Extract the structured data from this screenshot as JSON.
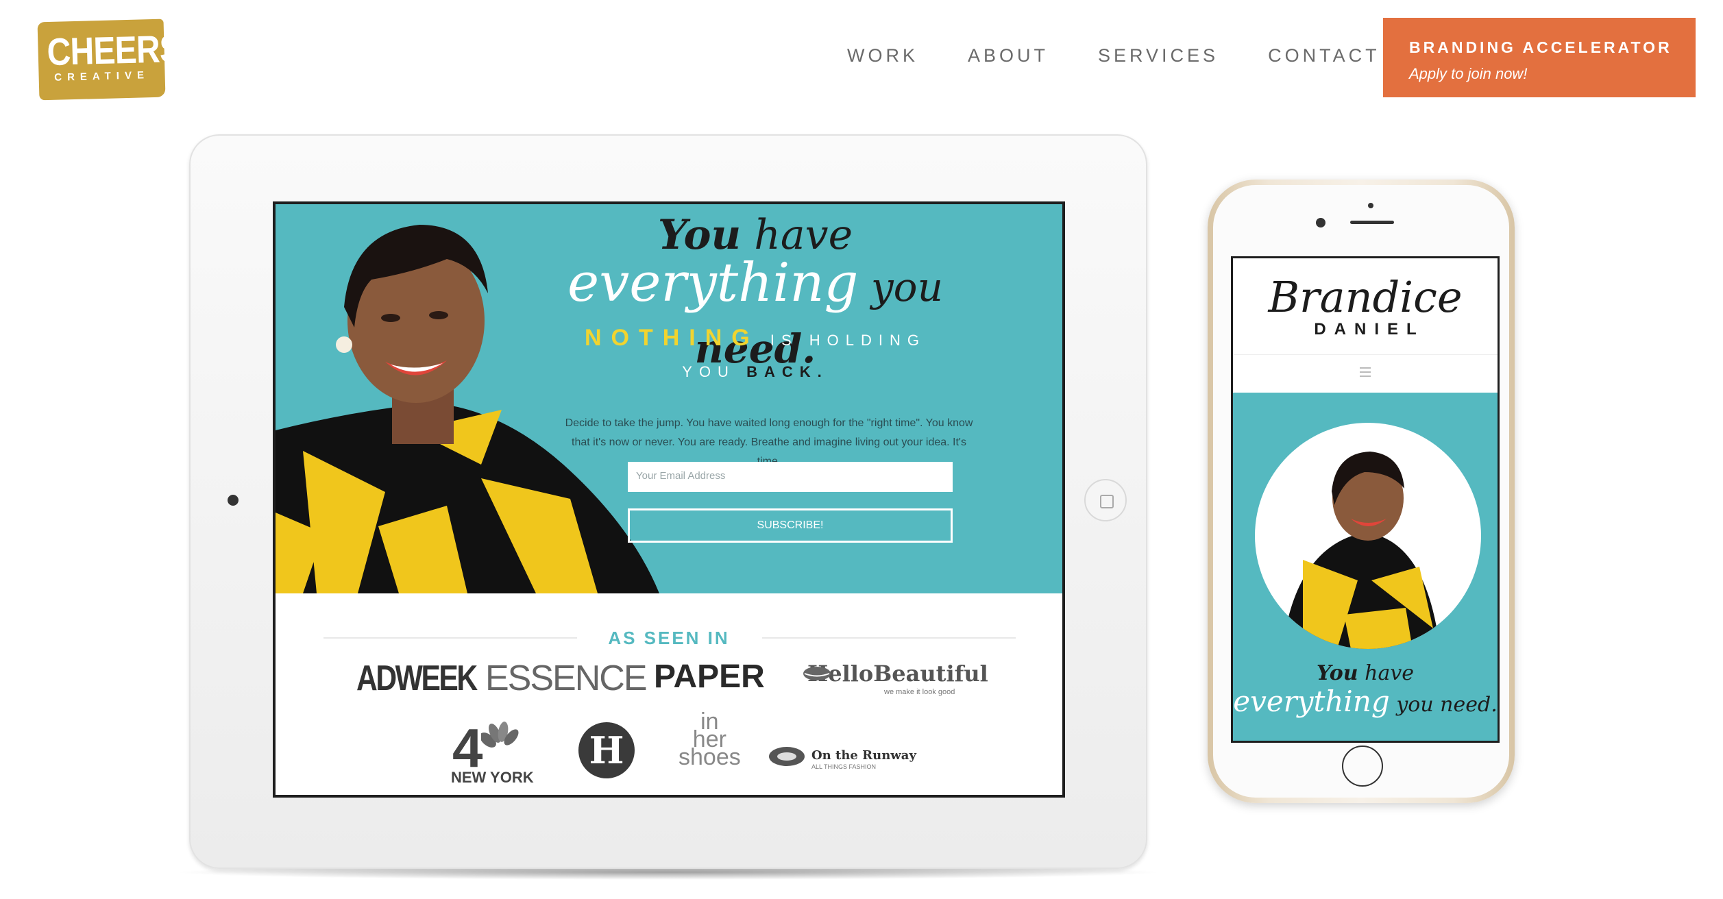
{
  "header": {
    "logo_main": "CHEERS",
    "logo_sub": "CREATIVE",
    "nav": [
      "WORK",
      "ABOUT",
      "SERVICES",
      "CONTACT"
    ],
    "cta_title": "BRANDING ACCELERATOR",
    "cta_subtitle": "Apply to join now!"
  },
  "tablet": {
    "headline_1a": "You",
    "headline_1b": " have",
    "headline_2a": "everything",
    "headline_2b": " you ",
    "headline_2c": "need.",
    "headline_3a": "NOTHING",
    "headline_3b": " IS HOLDING",
    "headline_4a": "YOU ",
    "headline_4b": "BACK.",
    "description": "Decide to take the jump. You have waited long enough for the \"right time\". You know that it's now or never. You are ready. Breathe and imagine living out your idea. It's time.",
    "email_placeholder": "Your Email Address",
    "subscribe_label": "SUBSCRIBE!",
    "as_seen_in": "AS SEEN IN",
    "brands_row1": [
      "ADWEEK",
      "ESSENCE",
      "PAPER",
      "HelloBeautiful"
    ],
    "brand_hb_tag": "we make it look good",
    "brands_row2_4": "4",
    "brands_row2_ny": "NEW YORK",
    "brands_row2_h": "H",
    "brands_row2_inher_1": "in",
    "brands_row2_inher_2": "her",
    "brands_row2_inher_3": "shoes",
    "brands_row2_runway": "On the Runway",
    "brands_row2_runway_tag": "ALL THINGS FASHION"
  },
  "phone": {
    "title": "Brandice",
    "subtitle": "DANIEL",
    "headline_1a": "You",
    "headline_1b": " have",
    "headline_2a": "everything",
    "headline_2b": " you need."
  },
  "colors": {
    "teal": "#55b9c0",
    "yellow": "#f1d42f",
    "cta_orange": "#e3703f",
    "logo_gold": "#c9a23c"
  }
}
